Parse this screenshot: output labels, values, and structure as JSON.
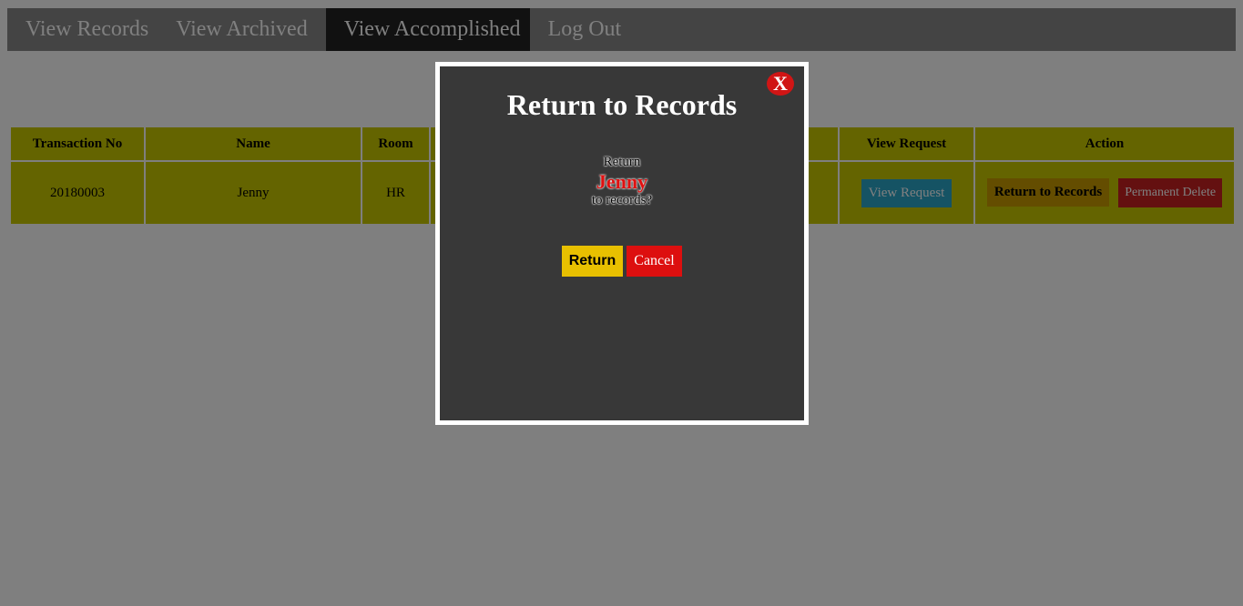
{
  "nav": {
    "items": [
      {
        "label": "View Records"
      },
      {
        "label": "View Archived"
      },
      {
        "label": "View Accomplished"
      },
      {
        "label": "Log Out"
      }
    ],
    "active_index": 2
  },
  "table": {
    "headers": {
      "transaction_no": "Transaction No",
      "name": "Name",
      "room": "Room",
      "view_request": "View Request",
      "action": "Action"
    },
    "row": {
      "transaction_no": "20180003",
      "name": "Jenny",
      "room": "HR",
      "view_request_label": "View Request",
      "return_label": "Return to Records",
      "delete_label": "Permanent Delete"
    }
  },
  "modal": {
    "title": "Return to Records",
    "close_label": "X",
    "message_prefix": "Return",
    "message_name": "Jenny",
    "message_suffix": "to records?",
    "return_label": "Return",
    "cancel_label": "Cancel"
  },
  "colors": {
    "table_bg": "#c8c800",
    "view_request_btn": "#2aa7c9",
    "return_records_btn": "#c89a00",
    "perm_delete_btn": "#c82020",
    "modal_bg": "#383838",
    "return_btn": "#e8c000",
    "cancel_btn": "#dd0f0f",
    "close_btn": "#d01515"
  }
}
